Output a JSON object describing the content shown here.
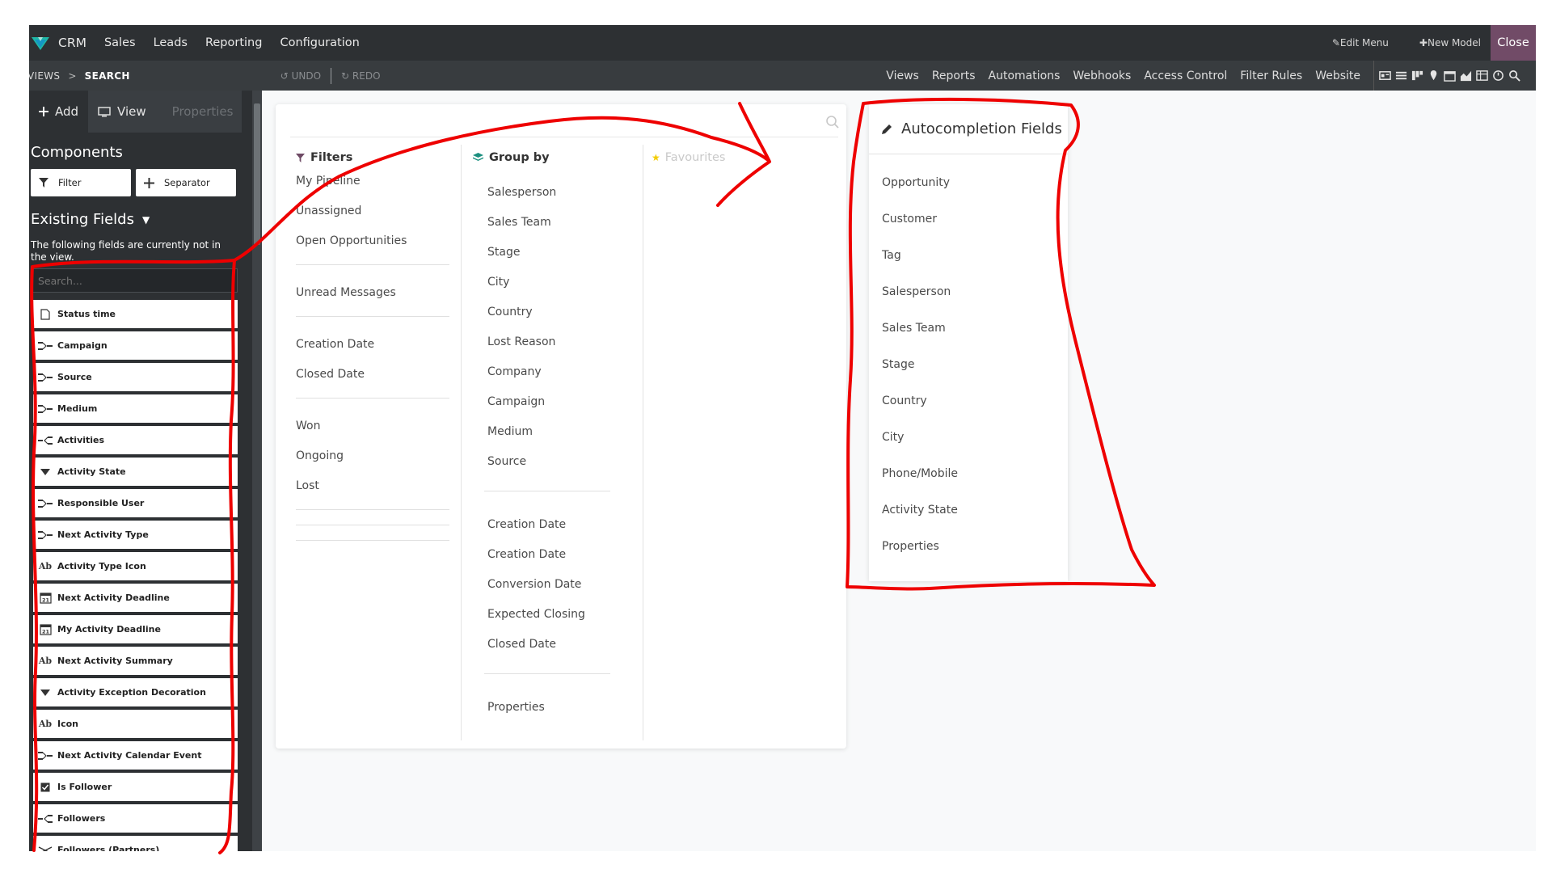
{
  "navbar": {
    "app_name": "CRM",
    "menus": [
      "Sales",
      "Leads",
      "Reporting",
      "Configuration"
    ],
    "edit_menu": "Edit Menu",
    "new_model": "New Model",
    "close": "Close"
  },
  "subbar": {
    "crumb_parent": "VIEWS",
    "crumb_sep": ">",
    "crumb_current": "SEARCH",
    "undo": "UNDO",
    "redo": "REDO",
    "tabs": [
      "Views",
      "Reports",
      "Automations",
      "Webhooks",
      "Access Control",
      "Filter Rules",
      "Website"
    ]
  },
  "sidebar": {
    "tab_add": "Add",
    "tab_view": "View",
    "tab_properties": "Properties",
    "components_title": "Components",
    "component_filter": "Filter",
    "component_separator": "Separator",
    "existing_fields_title": "Existing Fields",
    "note": "The following fields are currently not in the view.",
    "search_placeholder": "Search...",
    "fields": [
      {
        "label": "Status time",
        "icon": "document-icon"
      },
      {
        "label": "Campaign",
        "icon": "many2one-icon"
      },
      {
        "label": "Source",
        "icon": "many2one-icon"
      },
      {
        "label": "Medium",
        "icon": "many2one-icon"
      },
      {
        "label": "Activities",
        "icon": "one2many-icon"
      },
      {
        "label": "Activity State",
        "icon": "selection-icon"
      },
      {
        "label": "Responsible User",
        "icon": "many2one-icon"
      },
      {
        "label": "Next Activity Type",
        "icon": "many2one-icon"
      },
      {
        "label": "Activity Type Icon",
        "icon": "text-icon"
      },
      {
        "label": "Next Activity Deadline",
        "icon": "calendar-icon"
      },
      {
        "label": "My Activity Deadline",
        "icon": "calendar-icon"
      },
      {
        "label": "Next Activity Summary",
        "icon": "text-icon"
      },
      {
        "label": "Activity Exception Decoration",
        "icon": "selection-icon"
      },
      {
        "label": "Icon",
        "icon": "text-icon"
      },
      {
        "label": "Next Activity Calendar Event",
        "icon": "many2one-icon"
      },
      {
        "label": "Is Follower",
        "icon": "checkbox-icon"
      },
      {
        "label": "Followers",
        "icon": "one2many-icon"
      },
      {
        "label": "Followers (Partners)",
        "icon": "many2many-icon"
      }
    ]
  },
  "search_panel": {
    "filters_title": "Filters",
    "groupby_title": "Group by",
    "favourites_title": "Favourites",
    "filters": [
      [
        "My Pipeline",
        "Unassigned",
        "Open Opportunities"
      ],
      [
        "Unread Messages"
      ],
      [
        "Creation Date",
        "Closed Date"
      ],
      [
        "Won",
        "Ongoing",
        "Lost"
      ]
    ],
    "groupby": [
      [
        "Salesperson",
        "Sales Team",
        "Stage",
        "City",
        "Country",
        "Lost Reason",
        "Company",
        "Campaign",
        "Medium",
        "Source"
      ],
      [
        "Creation Date",
        "Creation Date",
        "Conversion Date",
        "Expected Closing",
        "Closed Date"
      ],
      [
        "Properties"
      ]
    ]
  },
  "autocompletion": {
    "title": "Autocompletion Fields",
    "items": [
      "Opportunity",
      "Customer",
      "Tag",
      "Salesperson",
      "Sales Team",
      "Stage",
      "Country",
      "City",
      "Phone/Mobile",
      "Activity State",
      "Properties"
    ]
  },
  "colors": {
    "navbar": "#2d3033",
    "subbar": "#383c3f",
    "accent": "#714b67",
    "annotation": "#ff0000"
  }
}
